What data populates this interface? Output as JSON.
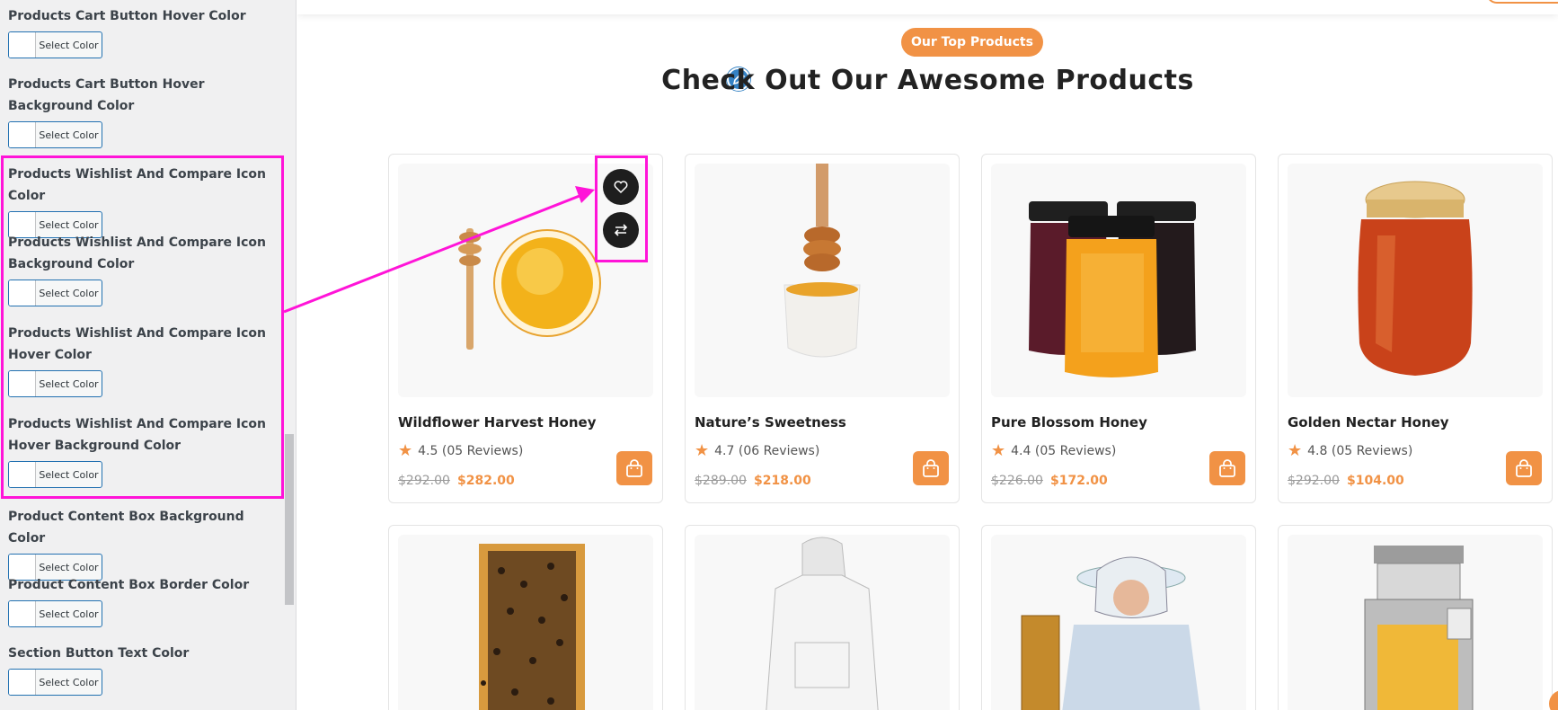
{
  "sidebar": {
    "settings": [
      {
        "label": "Products Cart Button Hover Color",
        "button": "Select Color"
      },
      {
        "label": "Products Cart Button Hover Background Color",
        "button": "Select Color"
      },
      {
        "label": "Products Wishlist And Compare Icon Color",
        "button": "Select Color"
      },
      {
        "label": "Products Wishlist And Compare Icon Background Color",
        "button": "Select Color"
      },
      {
        "label": "Products Wishlist And Compare Icon Hover Color",
        "button": "Select Color"
      },
      {
        "label": "Products Wishlist And Compare Icon Hover Background Color",
        "button": "Select Color"
      },
      {
        "label": "Product Content Box Background Color",
        "button": "Select Color"
      },
      {
        "label": "Product Content Box Border Color",
        "button": "Select Color"
      },
      {
        "label": "Section Button Text Color",
        "button": "Select Color"
      }
    ]
  },
  "section": {
    "badge": "Our Top Products",
    "title": "Check Out Our Awesome Products"
  },
  "products": [
    {
      "name": "Wildflower Harvest Honey",
      "rating": "4.5 (05 Reviews)",
      "old_price": "$292.00",
      "price": "$282.00",
      "image": "honey-dipper-bowl"
    },
    {
      "name": "Nature’s Sweetness",
      "rating": "4.7 (06 Reviews)",
      "old_price": "$289.00",
      "price": "$218.00",
      "image": "honey-pot-dipper"
    },
    {
      "name": "Pure Blossom Honey",
      "rating": "4.4 (05 Reviews)",
      "old_price": "$226.00",
      "price": "$172.00",
      "image": "three-jars"
    },
    {
      "name": "Golden Nectar Honey",
      "rating": "4.8 (05 Reviews)",
      "old_price": "$292.00",
      "price": "$104.00",
      "image": "jam-jar"
    }
  ],
  "products_row2": [
    {
      "image": "honeycomb-frame-bees"
    },
    {
      "image": "beekeeper-suit"
    },
    {
      "image": "beekeeper-holding-frame"
    },
    {
      "image": "honey-extractor-machine"
    }
  ],
  "icons": {
    "wishlist": "heart-icon",
    "compare": "arrows-swap-icon",
    "cart": "shopping-bag-icon",
    "rating": "star-icon",
    "edit": "pencil-icon"
  },
  "colors": {
    "accent": "#f19245",
    "annotation": "#ff14d8",
    "icon_bg": "#1e1e1e",
    "select_border": "#2271b1"
  }
}
